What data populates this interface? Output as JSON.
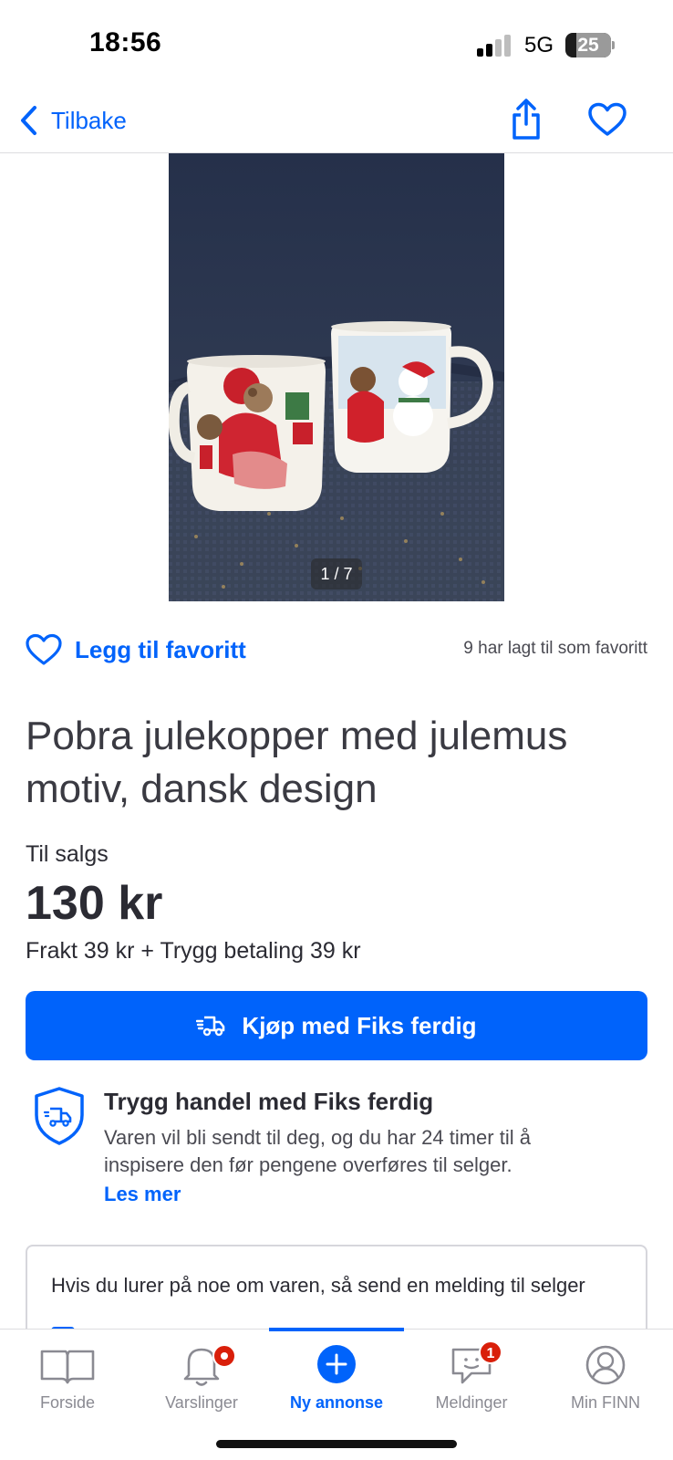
{
  "status_bar": {
    "time": "18:56",
    "network": "5G",
    "battery": "25"
  },
  "nav": {
    "back_label": "Tilbake",
    "share_icon": "share-icon",
    "favorite_icon": "heart-icon"
  },
  "image": {
    "counter": "1 / 7"
  },
  "favorite": {
    "label": "Legg til favoritt",
    "count_text": "9 har lagt til som favoritt"
  },
  "listing": {
    "title": "Pobra julekopper med julemus motiv, dansk design",
    "sale_label": "Til salgs",
    "price": "130 kr",
    "shipping": "Frakt 39 kr + Trygg betaling 39 kr"
  },
  "buy_button": {
    "label": "Kjøp med Fiks ferdig",
    "icon": "delivery-truck-icon"
  },
  "safe_trade": {
    "title": "Trygg handel med Fiks ferdig",
    "text": "Varen vil bli sendt til deg, og du har 24 timer til å inspisere den før pengene overføres til selger.",
    "link": "Les mer"
  },
  "message_card": {
    "text": "Hvis du lurer på noe om varen, så send en melding til selger"
  },
  "tabs": [
    {
      "label": "Forside",
      "icon": "book-icon"
    },
    {
      "label": "Varslinger",
      "icon": "bell-icon"
    },
    {
      "label": "Ny annonse",
      "icon": "plus-circle-icon"
    },
    {
      "label": "Meldinger",
      "icon": "chat-icon",
      "badge": "1"
    },
    {
      "label": "Min FINN",
      "icon": "user-circle-icon"
    }
  ],
  "colors": {
    "accent": "#0063fb",
    "badge": "#d91f0a",
    "text": "#2b2b33"
  }
}
